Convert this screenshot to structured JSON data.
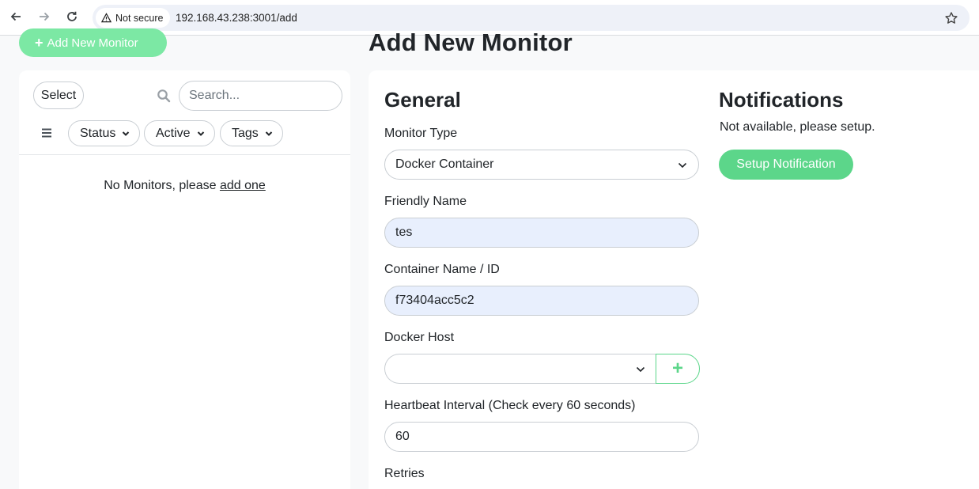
{
  "browser": {
    "security_label": "Not secure",
    "url": "192.168.43.238:3001/add"
  },
  "header": {
    "add_button_label": "Add New Monitor",
    "page_title": "Add New Monitor"
  },
  "sidebar": {
    "select_label": "Select",
    "search_placeholder": "Search...",
    "filters": [
      "Status",
      "Active",
      "Tags"
    ],
    "empty_text": "No Monitors, please ",
    "empty_link": "add one"
  },
  "general": {
    "title": "General",
    "monitor_type": {
      "label": "Monitor Type",
      "value": "Docker Container"
    },
    "friendly_name": {
      "label": "Friendly Name",
      "value": "tes"
    },
    "container": {
      "label": "Container Name / ID",
      "value": "f73404acc5c2"
    },
    "docker_host": {
      "label": "Docker Host",
      "value": "",
      "add_label": "+"
    },
    "heartbeat": {
      "label": "Heartbeat Interval (Check every 60 seconds)",
      "value": "60"
    },
    "retries": {
      "label": "Retries"
    }
  },
  "notifications": {
    "title": "Notifications",
    "text": "Not available, please setup.",
    "setup_button": "Setup Notification"
  },
  "colors": {
    "accent": "#5cd68a",
    "accent_light": "#7ce8a4",
    "filled_input": "#e8effd"
  }
}
